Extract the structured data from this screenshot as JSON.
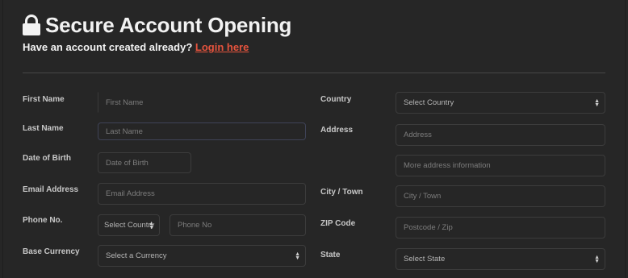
{
  "header": {
    "title": "Secure Account Opening",
    "subtitle_prefix": "Have an account created already?",
    "login_link": "Login here",
    "icon": "lock-icon"
  },
  "form": {
    "first_name": {
      "label": "First Name",
      "placeholder": "First Name"
    },
    "last_name": {
      "label": "Last Name",
      "placeholder": "Last Name"
    },
    "dob": {
      "label": "Date of Birth",
      "placeholder": "Date of Birth"
    },
    "email": {
      "label": "Email Address",
      "placeholder": "Email Address"
    },
    "phone": {
      "label": "Phone No.",
      "country_select": "Select Country",
      "placeholder": "Phone No"
    },
    "currency": {
      "label": "Base Currency",
      "select": "Select a Currency"
    },
    "country": {
      "label": "Country",
      "select": "Select Country"
    },
    "address": {
      "label": "Address",
      "placeholder": "Address",
      "placeholder2": "More address information"
    },
    "city": {
      "label": "City / Town",
      "placeholder": "City / Town"
    },
    "zip": {
      "label": "ZIP Code",
      "placeholder": "Postcode / Zip"
    },
    "state": {
      "label": "State",
      "select": "Select State"
    }
  },
  "colors": {
    "background": "#262626",
    "link": "#e5533d",
    "text": "#f2f2f2"
  }
}
